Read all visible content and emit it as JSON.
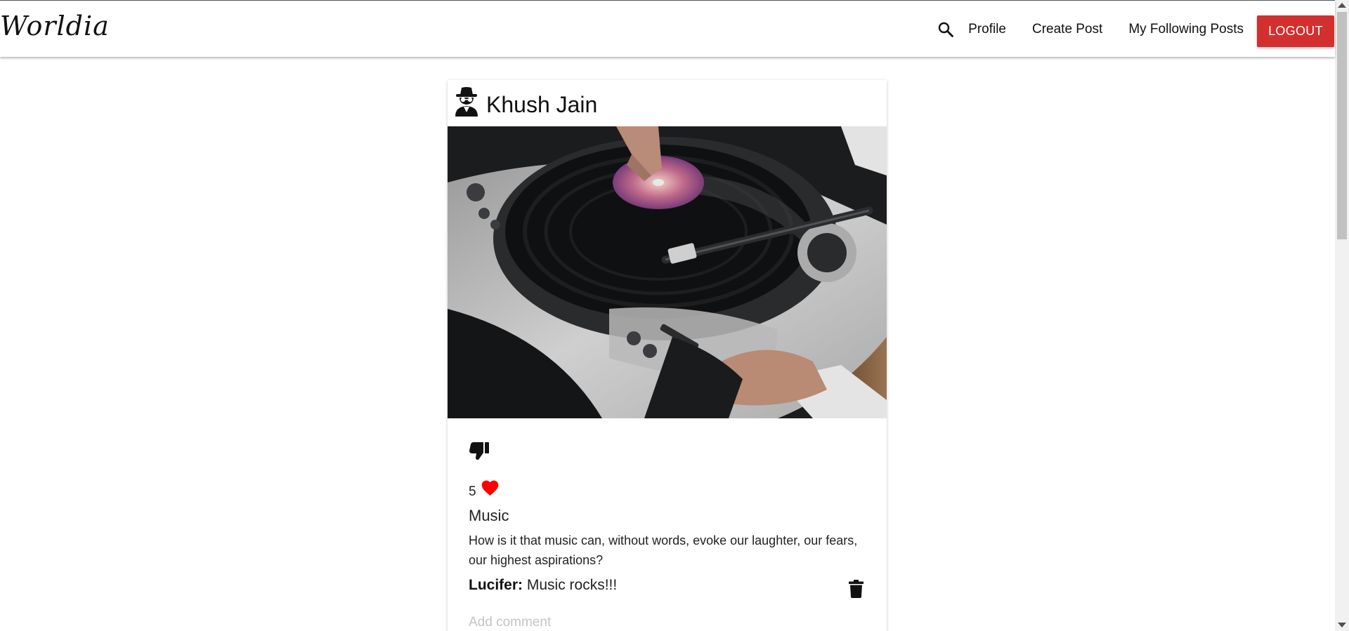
{
  "navbar": {
    "brand": "Worldia",
    "links": [
      "Profile",
      "Create Post",
      "My Following Posts"
    ],
    "logout_label": "LOGOUT",
    "logout_color": "#d32f2f"
  },
  "post": {
    "author": "Khush Jain",
    "likes_count": "5",
    "title": "Music",
    "body": "How is it that music can, without words, evoke our laughter, our fears, our highest aspirations?",
    "comments": [
      {
        "author": "Lucifer:",
        "text": "Music rocks!!!"
      }
    ],
    "comment_placeholder": "Add comment",
    "heart_color": "#ff0000"
  },
  "icons": {
    "search": "search-icon",
    "avatar": "spy-avatar-icon",
    "dislike": "thumbs-down-icon",
    "like": "heart-icon",
    "delete": "trash-icon"
  }
}
